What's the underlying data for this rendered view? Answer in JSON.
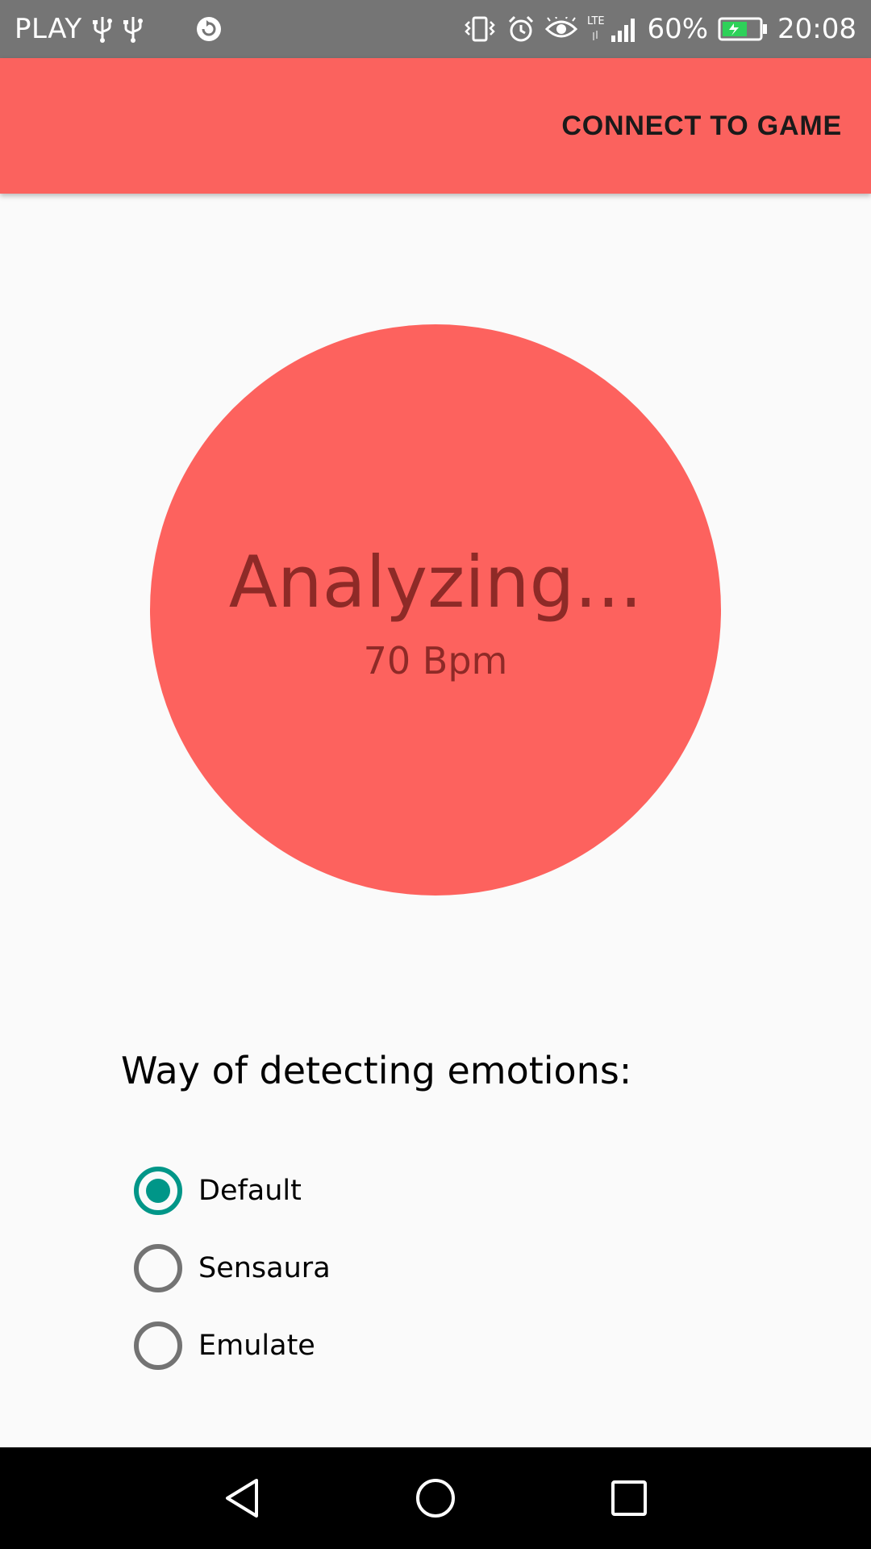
{
  "status_bar": {
    "carrier": "PLAY",
    "battery_percent": "60%",
    "time": "20:08",
    "network": "LTE",
    "icons": [
      "usb-icon",
      "usb-icon",
      "sync-icon",
      "vibrate-icon",
      "alarm-icon",
      "eye-icon",
      "signal-icon",
      "battery-charging-icon"
    ]
  },
  "app_bar": {
    "connect_label": "CONNECT TO GAME",
    "background_color": "#fb625e"
  },
  "status_circle": {
    "title": "Analyzing...",
    "bpm": "70 Bpm",
    "color": "#fd625e"
  },
  "detection": {
    "title": "Way of detecting emotions:",
    "options": [
      {
        "label": "Default",
        "checked": true
      },
      {
        "label": "Sensaura",
        "checked": false
      },
      {
        "label": "Emulate",
        "checked": false
      }
    ],
    "accent_color": "#009688"
  },
  "nav_bar": {
    "icons": [
      "back-icon",
      "home-icon",
      "recents-icon"
    ]
  }
}
